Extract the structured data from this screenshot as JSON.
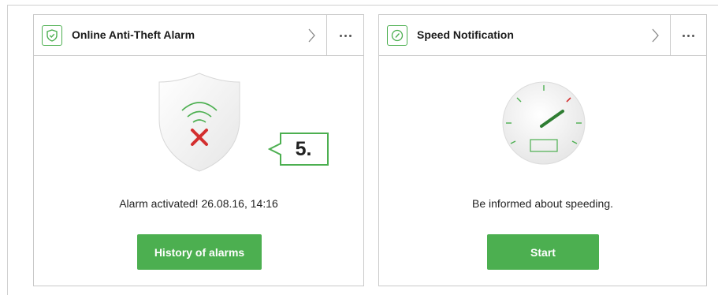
{
  "cards": [
    {
      "title": "Online Anti-Theft Alarm",
      "header_icon": "shield-check-icon",
      "illustration": "shield-alarm-icon",
      "status_text": "Alarm activated! 26.08.16, 14:16",
      "button_label": "History of alarms"
    },
    {
      "title": "Speed Notification",
      "header_icon": "speedometer-icon",
      "illustration": "speedometer-gauge-icon",
      "status_text": "Be informed about speeding.",
      "button_label": "Start"
    }
  ],
  "callout": {
    "label": "5."
  },
  "colors": {
    "accent": "#4caf50",
    "alert": "#d32f2f",
    "border": "#c9c9c9"
  }
}
